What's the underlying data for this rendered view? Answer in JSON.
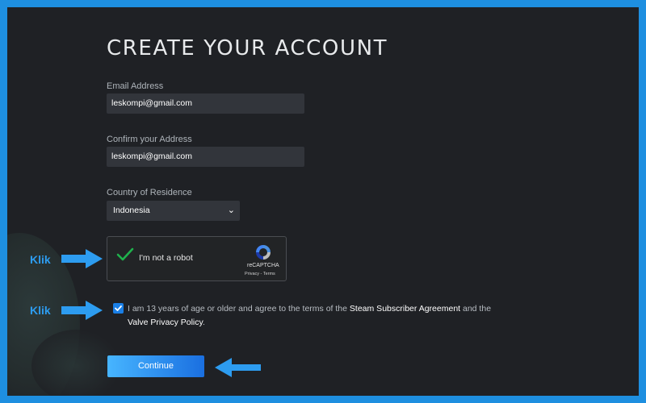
{
  "page": {
    "title": "CREATE YOUR ACCOUNT"
  },
  "form": {
    "email_label": "Email Address",
    "email_value": "leskompi@gmail.com",
    "confirm_label": "Confirm your Address",
    "confirm_value": "leskompi@gmail.com",
    "country_label": "Country of Residence",
    "country_value": "Indonesia"
  },
  "captcha": {
    "text": "I'm not a robot",
    "brand": "reCAPTCHA",
    "links": "Privacy - Terms",
    "checked": true
  },
  "agreement": {
    "checked": true,
    "text_1": "I am 13 years of age or older and agree to the terms of the ",
    "link_1": "Steam Subscriber Agreement",
    "text_2": " and the ",
    "link_2": "Valve Privacy Policy",
    "text_3": "."
  },
  "actions": {
    "continue_label": "Continue"
  },
  "annotations": {
    "klik_captcha": "Klik",
    "klik_agree": "Klik"
  },
  "colors": {
    "outer_border": "#1e8fe0",
    "background": "#1f2125",
    "input_bg": "#32353b",
    "button_gradient_start": "#47b5ff",
    "button_gradient_end": "#1a6fe0",
    "annotation": "#2d9cf0"
  }
}
